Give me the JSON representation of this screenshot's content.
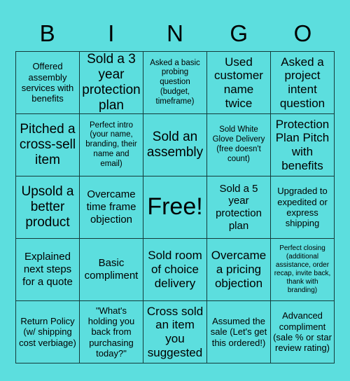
{
  "header": {
    "letters": [
      "B",
      "I",
      "N",
      "G",
      "O"
    ]
  },
  "grid": {
    "rows": [
      [
        {
          "text": "Offered assembly services with benefits",
          "size": "sm"
        },
        {
          "text": "Sold a 3 year protection plan",
          "size": "xl"
        },
        {
          "text": "Asked a basic probing question (budget, timeframe)",
          "size": "xs"
        },
        {
          "text": "Used customer name twice",
          "size": "lg"
        },
        {
          "text": "Asked a project intent question",
          "size": "lg"
        }
      ],
      [
        {
          "text": "Pitched a cross-sell item",
          "size": "xl"
        },
        {
          "text": "Perfect intro (your name, branding, their name and email)",
          "size": "xs"
        },
        {
          "text": "Sold an assembly",
          "size": "xl"
        },
        {
          "text": "Sold White Glove Delivery (free doesn't count)",
          "size": "xs"
        },
        {
          "text": "Protection Plan Pitch with benefits",
          "size": "lg"
        }
      ],
      [
        {
          "text": "Upsold a better product",
          "size": "xl"
        },
        {
          "text": "Overcame time frame objection",
          "size": "md"
        },
        {
          "text": "Free!",
          "size": "xxl"
        },
        {
          "text": "Sold a 5 year protection plan",
          "size": "md"
        },
        {
          "text": "Upgraded to expedited or express shipping",
          "size": "sm"
        }
      ],
      [
        {
          "text": "Explained next steps for a quote",
          "size": "md"
        },
        {
          "text": "Basic compliment",
          "size": "md"
        },
        {
          "text": "Sold room of choice delivery",
          "size": "lg"
        },
        {
          "text": "Overcame a pricing objection",
          "size": "lg"
        },
        {
          "text": "Perfect closing (additional assistance, order recap, invite back, thank with branding)",
          "size": "xxs"
        }
      ],
      [
        {
          "text": "Return Policy (w/ shipping cost verbiage)",
          "size": "sm"
        },
        {
          "text": "\"What's holding you back from purchasing today?\"",
          "size": "sm"
        },
        {
          "text": "Cross sold an item you suggested",
          "size": "lg"
        },
        {
          "text": "Assumed the sale (Let's get this ordered!)",
          "size": "sm"
        },
        {
          "text": "Advanced compliment (sale % or star review rating)",
          "size": "sm"
        }
      ]
    ]
  },
  "colors": {
    "background": "#5cdede",
    "cell_background": "#5cdede",
    "border": "#143b3b",
    "text": "#000000"
  }
}
